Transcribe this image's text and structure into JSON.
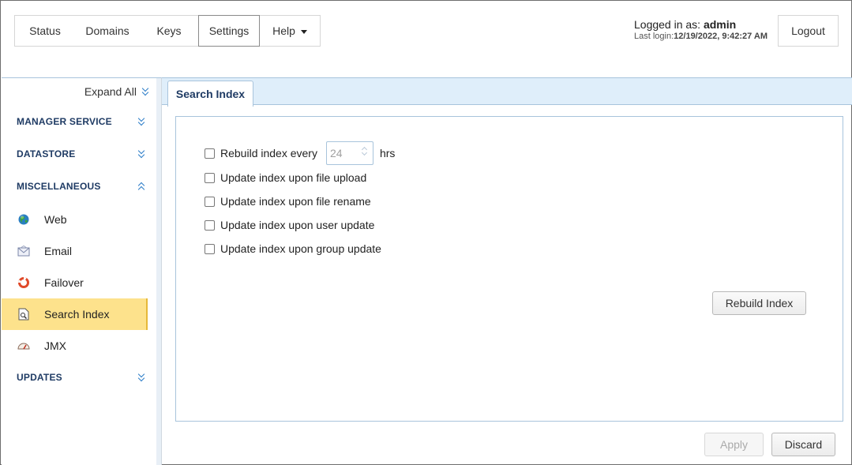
{
  "nav": {
    "items": [
      {
        "label": "Status"
      },
      {
        "label": "Domains"
      },
      {
        "label": "Keys"
      },
      {
        "label": "Settings"
      },
      {
        "label": "Help"
      }
    ],
    "active": "Settings"
  },
  "user": {
    "logged_in_prefix": "Logged in as: ",
    "username": "admin",
    "last_login_prefix": "Last login:",
    "last_login": "12/19/2022, 9:42:27 AM",
    "logout_label": "Logout"
  },
  "sidebar": {
    "expand_all": "Expand All",
    "sections": [
      {
        "label": "MANAGER SERVICE",
        "expanded": false
      },
      {
        "label": "DATASTORE",
        "expanded": false
      },
      {
        "label": "MISCELLANEOUS",
        "expanded": true
      },
      {
        "label": "UPDATES",
        "expanded": false
      }
    ],
    "items": [
      {
        "label": "Web",
        "icon": "globe-icon"
      },
      {
        "label": "Email",
        "icon": "envelope-icon"
      },
      {
        "label": "Failover",
        "icon": "lifebuoy-icon"
      },
      {
        "label": "Search Index",
        "icon": "search-document-icon",
        "active": true
      },
      {
        "label": "JMX",
        "icon": "gauge-icon"
      }
    ]
  },
  "tab": {
    "label": "Search Index"
  },
  "form": {
    "rebuild_every_label": "Rebuild index every",
    "rebuild_every_value": "24",
    "rebuild_every_unit": "hrs",
    "options": [
      {
        "label": "Update index upon file upload",
        "checked": false
      },
      {
        "label": "Update index upon file rename",
        "checked": false
      },
      {
        "label": "Update index upon user update",
        "checked": false
      },
      {
        "label": "Update index upon group update",
        "checked": false
      }
    ],
    "rebuild_checked": false,
    "rebuild_button": "Rebuild Index"
  },
  "footer": {
    "apply_label": "Apply",
    "discard_label": "Discard"
  },
  "colors": {
    "accent_dark": "#1f3b64",
    "active_item_bg": "#fde28c",
    "tabbar_bg": "#dfeefa",
    "chevron": "#2d7dc8"
  }
}
